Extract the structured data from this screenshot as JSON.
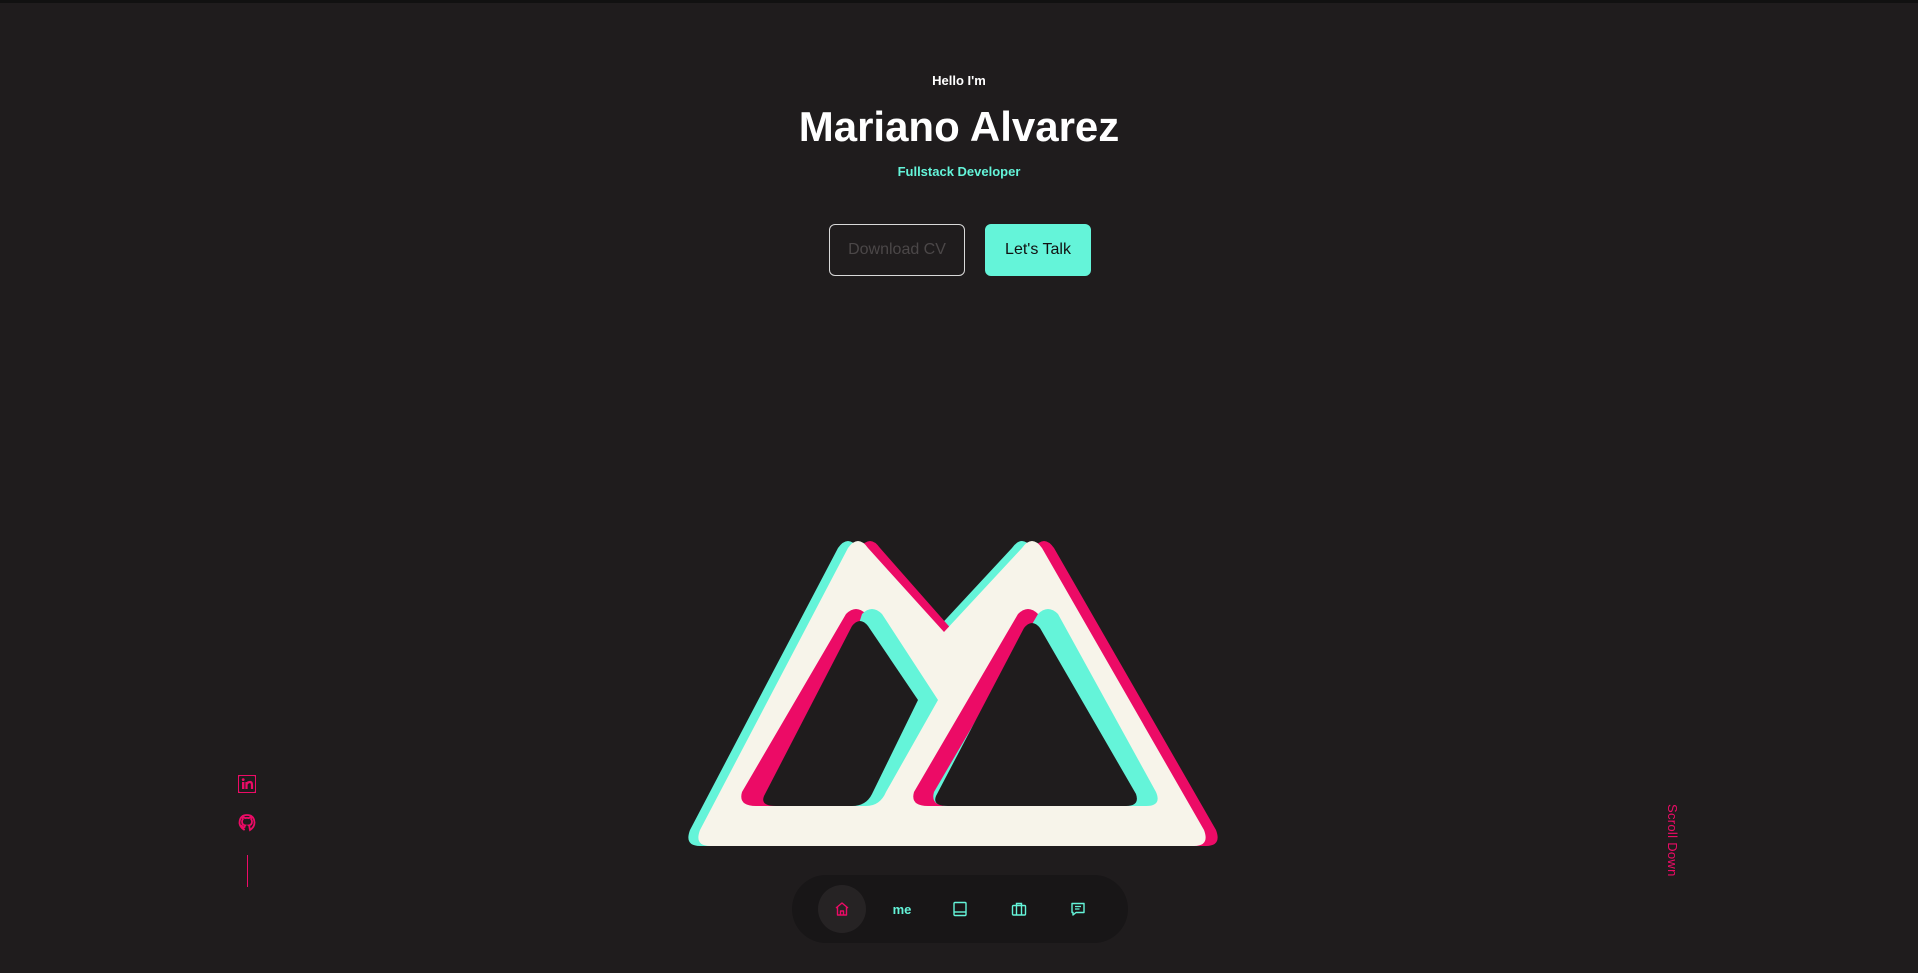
{
  "hero": {
    "greeting": "Hello I'm",
    "name": "Mariano Alvarez",
    "role": "Fullstack Developer",
    "download_label": "Download CV",
    "talk_label": "Let's Talk"
  },
  "socials": [
    {
      "icon": "linkedin-icon"
    },
    {
      "icon": "github-icon"
    }
  ],
  "scroll_label": "Scroll Down",
  "nav": {
    "items": [
      {
        "icon": "home-icon",
        "active": true
      },
      {
        "label": "me"
      },
      {
        "icon": "book-icon"
      },
      {
        "icon": "briefcase-icon"
      },
      {
        "icon": "message-icon"
      }
    ]
  },
  "colors": {
    "background": "#1f1c1d",
    "accent_cyan": "#64f4d9",
    "accent_pink": "#ec0b66",
    "logo_fill": "#f7f4ea"
  }
}
